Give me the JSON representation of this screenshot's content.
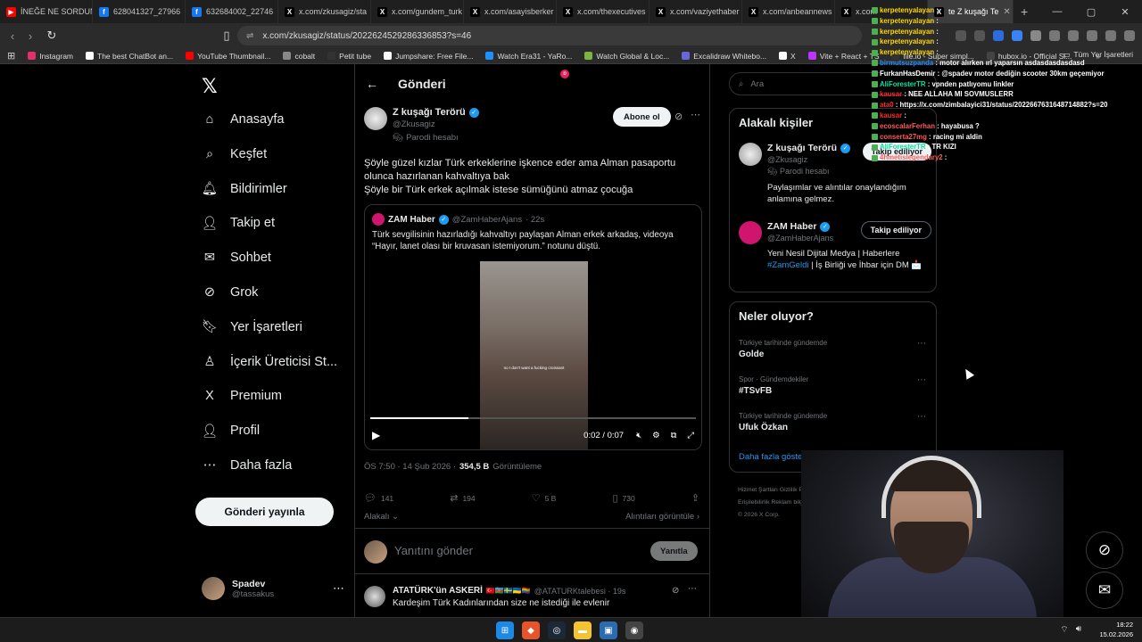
{
  "browser": {
    "tabs": [
      {
        "label": "İNEĞE NE SORDUN",
        "color": "#ff0000",
        "glyph": "▶"
      },
      {
        "label": "628041327_27966",
        "color": "#1877f2",
        "glyph": "f"
      },
      {
        "label": "632684002_22746",
        "color": "#1877f2",
        "glyph": "f"
      },
      {
        "label": "x.com/zkusagiz/sta",
        "color": "#000000",
        "glyph": "X"
      },
      {
        "label": "x.com/gundem_turk",
        "color": "#000000",
        "glyph": "X"
      },
      {
        "label": "x.com/asayisberker",
        "color": "#000000",
        "glyph": "X"
      },
      {
        "label": "x.com/thexecutives",
        "color": "#000000",
        "glyph": "X"
      },
      {
        "label": "x.com/vaziyethaber",
        "color": "#000000",
        "glyph": "X"
      },
      {
        "label": "x.com/anbeannews",
        "color": "#000000",
        "glyph": "X"
      },
      {
        "label": "x.com",
        "color": "#000000",
        "glyph": "X"
      }
    ],
    "active_tab": "te Z kuşağı Te",
    "new_tab": "+",
    "url": "x.com/zkusagiz/status/2022624529286336853?s=46",
    "bookmarks": [
      {
        "label": "Instagram",
        "color": "#e1306c"
      },
      {
        "label": "The best ChatBot an...",
        "color": "#ffffff"
      },
      {
        "label": "YouTube Thumbnail...",
        "color": "#ff0000"
      },
      {
        "label": "cobalt",
        "color": "#888888"
      },
      {
        "label": "Petit tube",
        "color": "#333333"
      },
      {
        "label": "Jumpshare: Free File...",
        "color": "#ffffff"
      },
      {
        "label": "Watch Era31 - YaRo...",
        "color": "#1e90ff"
      },
      {
        "label": "Watch Global & Loc...",
        "color": "#7cb342"
      },
      {
        "label": "Excalidraw Whitebo...",
        "color": "#6965db"
      },
      {
        "label": "X",
        "color": "#ffffff"
      },
      {
        "label": "Vite + React + TS",
        "color": "#bd34fe"
      },
      {
        "label": "file.io - Super simpl...",
        "color": "#333333"
      },
      {
        "label": "hubox.io - Official Si...",
        "color": "#444444"
      },
      {
        "label": "»",
        "color": "#2b2b2b"
      }
    ],
    "all_bookmarks": "Tüm Yer İşaretleri"
  },
  "nav": {
    "items": [
      {
        "label": "Anasayfa",
        "icon": "⌂"
      },
      {
        "label": "Keşfet",
        "icon": "⌕"
      },
      {
        "label": "Bildirimler",
        "icon": "🔔︎"
      },
      {
        "label": "Takip et",
        "icon": "👤︎"
      },
      {
        "label": "Sohbet",
        "icon": "✉"
      },
      {
        "label": "Grok",
        "icon": "⊘"
      },
      {
        "label": "Yer İşaretleri",
        "icon": "🔖︎"
      },
      {
        "label": "İçerik Üreticisi St...",
        "icon": "♙"
      },
      {
        "label": "Premium",
        "icon": "X"
      },
      {
        "label": "Profil",
        "icon": "👤︎"
      },
      {
        "label": "Daha fazla",
        "icon": "⋯"
      }
    ],
    "post_button": "Gönderi yayınla",
    "account": {
      "name": "Spadev",
      "handle": "@tassakus",
      "more": "⋯"
    }
  },
  "post": {
    "back": "←",
    "header": "Gönderi",
    "author_name": "Z kuşağı Terörü",
    "author_handle": "@Zkusagiz",
    "parody_label": "Parodi hesabı",
    "follow_label": "Abone ol",
    "text_lines": [
      "Şöyle güzel kızlar Türk erkeklerine işkence eder ama Alman pasaportu olunca hazırlanan kahvaltıya bak",
      "Şöyle bir Türk erkek açılmak istese sümüğünü atmaz çocuğa"
    ],
    "quote": {
      "name": "ZAM Haber",
      "handle": "@ZamHaberAjans",
      "time": "· 22s",
      "text": "Türk sevgilisinin hazırladığı kahvaltıyı paylaşan Alman erkek arkadaş, videoya “Hayır, lanet olası bir kruvasan istemiyorum.” notunu düştü.",
      "video_caption": "no I don't want a fucking croissant",
      "video_time": "0:02 / 0:07",
      "progress": 0.3
    },
    "meta_time": "ÖS 7:50 · 14 Şub 2026 ·",
    "views": "354,5 B",
    "views_label": "Görüntüleme",
    "stats": {
      "replies": "141",
      "reposts": "194",
      "likes": "5 B",
      "bookmarks": "730"
    },
    "relevance": "Alakalı",
    "quotes_link": "Alıntıları görüntüle ›",
    "reply_placeholder": "Yanıtını gönder",
    "reply_button": "Yanıtla",
    "next_tweet": {
      "name": "ATATÜRK'ün ASKERİ",
      "handle": "@ATATURKtalebesi · 19s",
      "text": "Kardeşim Türk Kadınlarından size ne istediği ile evlenir"
    }
  },
  "sidebar": {
    "search_placeholder": "Ara",
    "related_title": "Alakalı kişiler",
    "people": [
      {
        "name": "Z kuşağı Terörü",
        "handle": "@Zkusagiz",
        "sub": "Parodi hesabı",
        "button": "Takip ediliyor",
        "bio": "Paylaşımlar ve alıntılar onaylandığım anlamına gelmez."
      },
      {
        "name": "ZAM Haber",
        "handle": "@ZamHaberAjans",
        "button": "Takip ediliyor",
        "bio_plain": "Yeni Nesil Dijital Medya | Haberlere ",
        "bio_link": "#ZamGeldi",
        "bio_rest": " | İş Birliği ve İhbar için DM 📩"
      }
    ],
    "trends_title": "Neler oluyor?",
    "trends": [
      {
        "context": "Türkiye tarihinde gündemde",
        "name": "Golde"
      },
      {
        "context": "Spor · Gündemdekiler",
        "name": "#TSvFB"
      },
      {
        "context": "Türkiye tarihinde gündemde",
        "name": "Ufuk Özkan"
      }
    ],
    "show_more": "Daha fazla göster",
    "footer_lines": [
      "Hizmet Şartları    Gizlilik Politikası    Çerez P",
      "Erişilebilirlik    Reklam bilgisi    Daha fazla ...",
      "© 2026 X Corp."
    ]
  },
  "chat": [
    {
      "user": "kerpetenyalayan",
      "msg": "",
      "color": "#ffd700"
    },
    {
      "user": "kerpetenyalayan",
      "msg": "",
      "color": "#ffd700"
    },
    {
      "user": "kerpetenyalayan",
      "msg": "",
      "color": "#ffd700"
    },
    {
      "user": "kerpetenyalayan",
      "msg": "",
      "color": "#ffd700"
    },
    {
      "user": "kerpetenyalayan",
      "msg": "",
      "color": "#ffd700"
    },
    {
      "user": "birmutsuzpanda",
      "msg": "motor alırken ırl yaparsın asdasdasdasdasd",
      "color": "#1e90ff"
    },
    {
      "user": "FurkanHasDemir",
      "msg": "@spadev motor dediğin scooter 30km geçemiyor",
      "color": "#ffffff"
    },
    {
      "user": "AliForesterTR",
      "msg": "vpnden patlıyomu linkler",
      "color": "#00e5a0"
    },
    {
      "user": "kausar",
      "msg": "NEE ALLAHA MI SOVMUSLERR",
      "color": "#ff2a2a"
    },
    {
      "user": "ata0",
      "msg": "https://x.com/zimbalayici31/status/2022667631648714882?s=20",
      "color": "#ff2a2a"
    },
    {
      "user": "kausar",
      "msg": "",
      "color": "#ff2a2a"
    },
    {
      "user": "ecoscalarFerhan",
      "msg": "hayabusa ?",
      "color": "#ff5a5a"
    },
    {
      "user": "conserta27mg",
      "msg": "racing mi aldin",
      "color": "#ff5a5a"
    },
    {
      "user": "AliForesterTR",
      "msg": "TR KIZI",
      "color": "#00e5a0"
    },
    {
      "user": "4hmetislegendary2",
      "msg": "",
      "color": "#ff5a5a"
    }
  ],
  "taskbar": {
    "time": "18:22",
    "date": "15.02.2026"
  }
}
